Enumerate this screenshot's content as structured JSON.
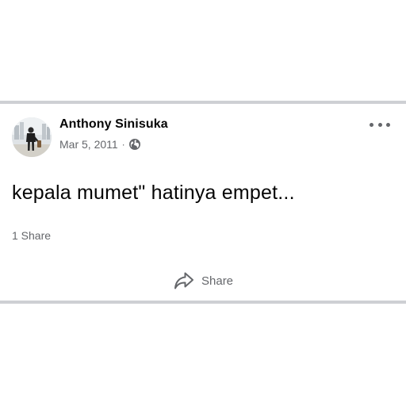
{
  "post": {
    "author_name": "Anthony Sinisuka",
    "date": "Mar 5, 2011",
    "separator": "·",
    "audience_icon": "globe-icon",
    "more_icon": "more-options-icon",
    "text": "kepala mumet\" hatinya empet...",
    "share_count": "1 Share",
    "actions": {
      "share_label": "Share",
      "share_icon": "share-arrow-icon"
    }
  },
  "colors": {
    "divider": "#ced0d4",
    "primary_text": "#050505",
    "secondary_text": "#65676b"
  }
}
